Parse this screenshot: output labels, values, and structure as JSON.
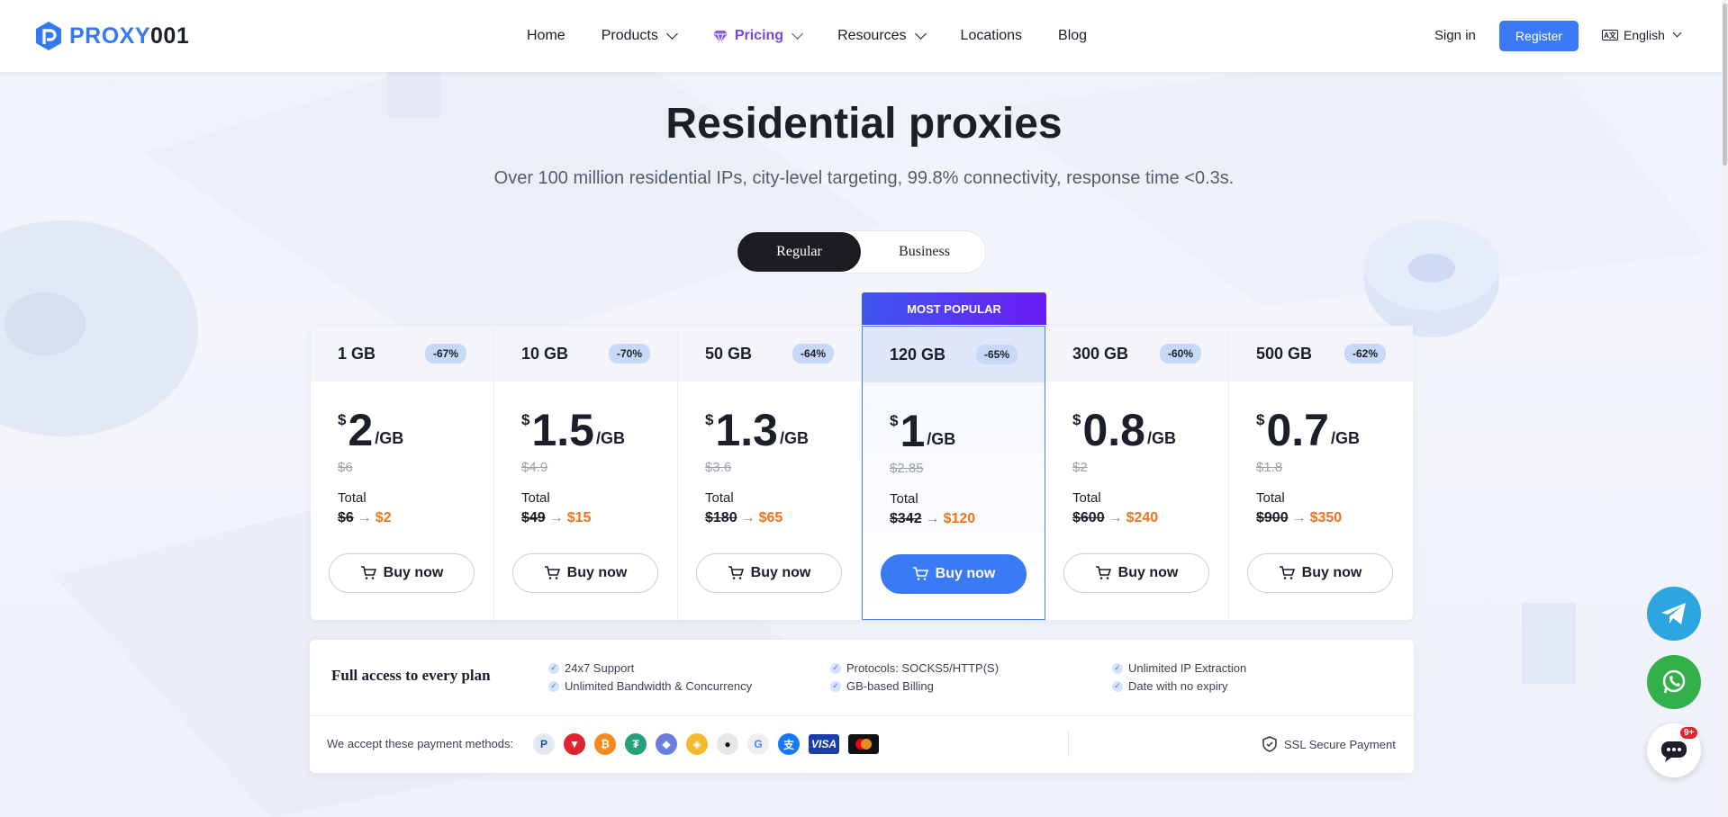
{
  "brand": {
    "name_part1": "PROXY",
    "name_part2": "001"
  },
  "nav": {
    "items": [
      {
        "label": "Home"
      },
      {
        "label": "Products"
      },
      {
        "label": "Pricing"
      },
      {
        "label": "Resources"
      },
      {
        "label": "Locations"
      },
      {
        "label": "Blog"
      }
    ],
    "sign_in": "Sign in",
    "register": "Register",
    "language": "English"
  },
  "hero": {
    "title": "Residential proxies",
    "subtitle": "Over 100 million residential IPs, city-level targeting, 99.8% connectivity, response time <0.3s."
  },
  "plan_toggle": {
    "active": "Regular",
    "inactive": "Business"
  },
  "popular_tag": "MOST POPULAR",
  "plans": [
    {
      "size": "1 GB",
      "discount": "-67%",
      "currency": "$",
      "price": "2",
      "unit": "/GB",
      "old_price": "$6",
      "total_label": "Total",
      "total_from": "$6",
      "total_to": "$2",
      "buy": "Buy now"
    },
    {
      "size": "10 GB",
      "discount": "-70%",
      "currency": "$",
      "price": "1.5",
      "unit": "/GB",
      "old_price": "$4.9",
      "total_label": "Total",
      "total_from": "$49",
      "total_to": "$15",
      "buy": "Buy now"
    },
    {
      "size": "50 GB",
      "discount": "-64%",
      "currency": "$",
      "price": "1.3",
      "unit": "/GB",
      "old_price": "$3.6",
      "total_label": "Total",
      "total_from": "$180",
      "total_to": "$65",
      "buy": "Buy now"
    },
    {
      "size": "120 GB",
      "discount": "-65%",
      "currency": "$",
      "price": "1",
      "unit": "/GB",
      "old_price": "$2.85",
      "total_label": "Total",
      "total_from": "$342",
      "total_to": "$120",
      "buy": "Buy now"
    },
    {
      "size": "300 GB",
      "discount": "-60%",
      "currency": "$",
      "price": "0.8",
      "unit": "/GB",
      "old_price": "$2",
      "total_label": "Total",
      "total_from": "$600",
      "total_to": "$240",
      "buy": "Buy now"
    },
    {
      "size": "500 GB",
      "discount": "-62%",
      "currency": "$",
      "price": "0.7",
      "unit": "/GB",
      "old_price": "$1.8",
      "total_label": "Total",
      "total_from": "$900",
      "total_to": "$350",
      "buy": "Buy now"
    }
  ],
  "features": {
    "title": "Full access to every plan",
    "items": [
      "24x7 Support",
      "Unlimited Bandwidth & Concurrency",
      "Protocols: SOCKS5/HTTP(S)",
      "GB-based Billing",
      "Unlimited IP Extraction",
      "Date with no expiry"
    ]
  },
  "payment": {
    "label": "We accept these payment methods:",
    "methods": [
      "paypal-icon",
      "tron-icon",
      "bitcoin-icon",
      "tether-icon",
      "ethereum-icon",
      "binance-icon",
      "apple-pay-icon",
      "google-pay-icon",
      "alipay-icon",
      "visa-icon",
      "mastercard-icon"
    ],
    "visa_text": "VISA",
    "ssl": "SSL Secure Payment"
  },
  "chat_badge": "9+",
  "colors": {
    "accent": "#3a7af5",
    "orange": "#f0741b",
    "purple": "#7446e6"
  }
}
